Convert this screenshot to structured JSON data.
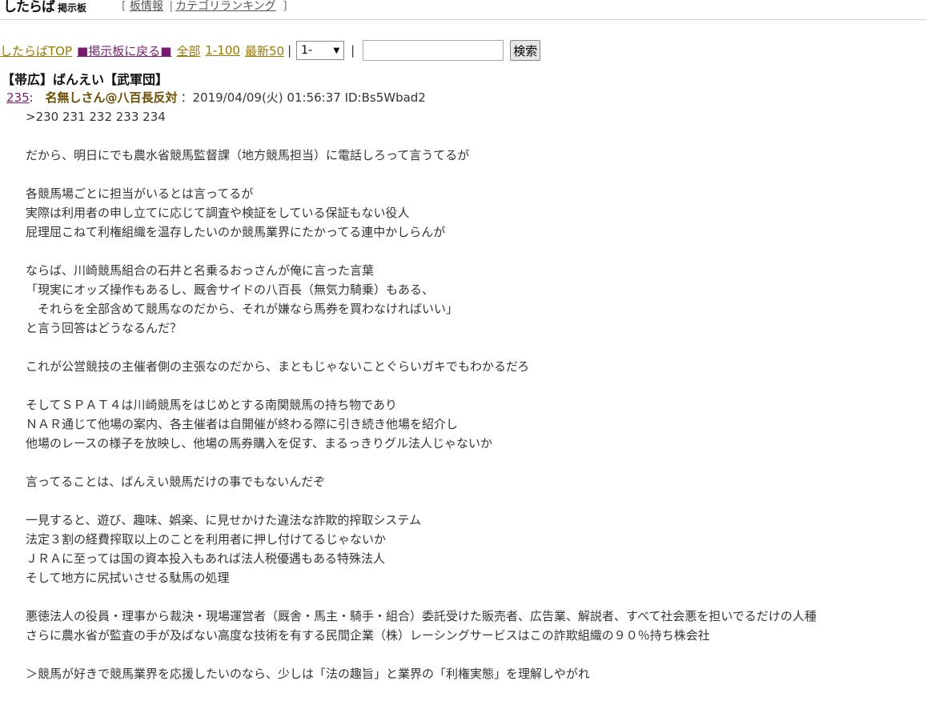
{
  "header": {
    "logo_main": "したらば",
    "logo_sub": "掲示板",
    "nav_open": "[",
    "nav_board_info": "板情報",
    "nav_sep": "|",
    "nav_category_ranking": "カテゴリランキング",
    "nav_close": "]"
  },
  "nav": {
    "top_link": "したらばTOP",
    "back_link": "■掲示板に戻る■",
    "all_link": "全部",
    "range_link": "1-100",
    "latest_link": "最新50",
    "sep": "|",
    "select_value": "1-",
    "search_value": "",
    "search_button": "検索"
  },
  "thread": {
    "title": "【帯広】ばんえい【武軍団】"
  },
  "post": {
    "number": "235",
    "colon": ":",
    "name": "名無しさん@八百長反対",
    "meta": "：2019/04/09(火) 01:56:37 ID:Bs5Wbad2",
    "lines": [
      ">230 231 232 233 234",
      "",
      "だから、明日にでも農水省競馬監督課（地方競馬担当）に電話しろって言うてるが",
      "",
      "各競馬場ごとに担当がいるとは言ってるが",
      "実際は利用者の申し立てに応じて調査や検証をしている保証もない役人",
      "屁理屈こねて利権組織を温存したいのか競馬業界にたかってる連中かしらんが",
      "",
      "ならば、川崎競馬組合の石井と名乗るおっさんが俺に言った言葉",
      "「現実にオッズ操作もあるし、厩舎サイドの八百長（無気力騎乗）もある、",
      "　それらを全部含めて競馬なのだから、それが嫌なら馬券を買わなければいい」",
      "と言う回答はどうなるんだ？",
      "",
      "これが公営競技の主催者側の主張なのだから、まともじゃないことぐらいガキでもわかるだろ",
      "",
      "そしてＳＰＡＴ４は川崎競馬をはじめとする南関競馬の持ち物であり",
      "ＮＡＲ通じて他場の案内、各主催者は自開催が終わる際に引き続き他場を紹介し",
      "他場のレースの様子を放映し、他場の馬券購入を促す、まるっきりグル法人じゃないか",
      "",
      "言ってることは、ばんえい競馬だけの事でもないんだぞ",
      "",
      "一見すると、遊び、趣味、娯楽、に見せかけた違法な詐欺的搾取システム",
      "法定３割の経費搾取以上のことを利用者に押し付けてるじゃないか",
      "ＪＲＡに至っては国の資本投入もあれば法人税優遇もある特殊法人",
      "そして地方に尻拭いさせる駄馬の処理",
      "",
      "悪徳法人の役員・理事から裁決・現場運営者（厩舎・馬主・騎手・組合）委託受けた販売者、広告業、解説者、すべて社会悪を担いでるだけの人種",
      "さらに農水省が監査の手が及ばない高度な技術を有する民間企業（株）レーシングサービスはこの詐欺組織の９０％持ち株会社",
      "",
      "＞競馬が好きで競馬業界を応援したいのなら、少しは「法の趣旨」と業界の「利権実態」を理解しやがれ"
    ]
  }
}
